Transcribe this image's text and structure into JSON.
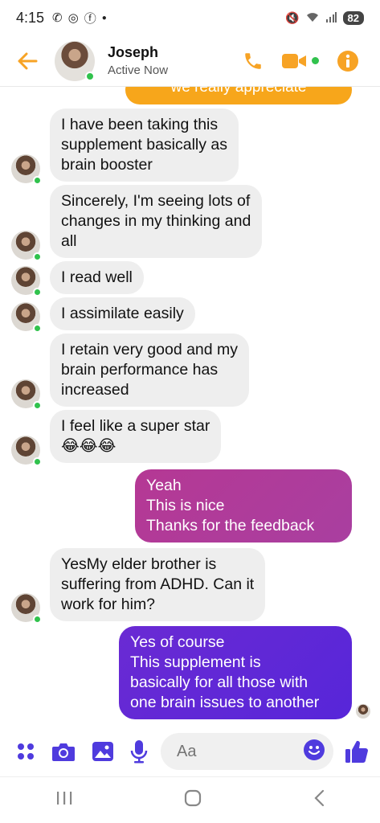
{
  "status_bar": {
    "time": "4:15",
    "battery": "82"
  },
  "header": {
    "contact_name": "Joseph",
    "contact_status": "Active Now"
  },
  "messages": {
    "partial_top": "we really appreciate",
    "m1": "I have been taking this\nsupplement basically as\nbrain booster",
    "m2": "Sincerely, I'm seeing lots of\nchanges  in my thinking and\nall",
    "m3": "I read well",
    "m4": "I assimilate easily",
    "m5": "I retain very good and my\nbrain performance has\nincreased",
    "m6": "I feel like a super star\n😂😂😂",
    "m7": "Yeah\nThis is nice\nThanks for the feedback",
    "m8": "YesMy elder brother is\nsuffering from ADHD. Can it\nwork for him?",
    "m9": "Yes of course\nThis supplement is\nbasically for all those with\none brain issues to another"
  },
  "composer": {
    "placeholder": "Aa"
  },
  "colors": {
    "accent": "#f7a325",
    "messenger_purple": "#4f3bde",
    "online": "#31c24d"
  },
  "icons": [
    "back-arrow-icon",
    "phone-icon",
    "video-camera-icon",
    "info-icon",
    "apps-icon",
    "camera-icon",
    "gallery-icon",
    "microphone-icon",
    "emoji-icon",
    "thumbs-up-icon",
    "recent-apps-icon",
    "home-icon",
    "back-icon"
  ]
}
